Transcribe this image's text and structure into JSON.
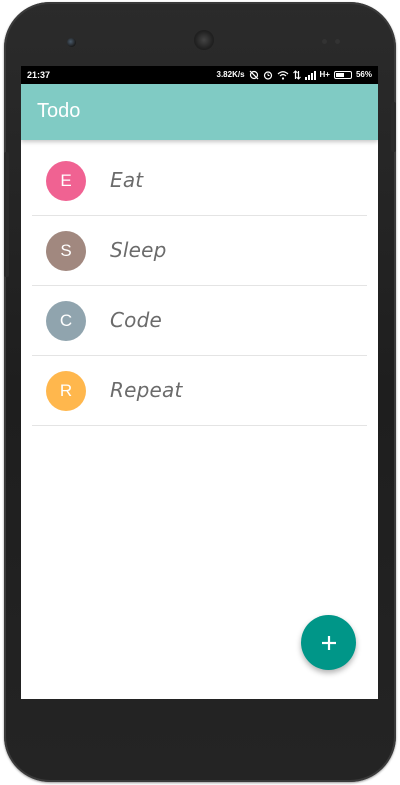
{
  "statusbar": {
    "time": "21:37",
    "network_speed": "3.82K/s",
    "network_type": "H+",
    "battery_percent": "56%",
    "battery_level": 0.56
  },
  "appbar": {
    "title": "Todo",
    "color": "#80cbc4"
  },
  "todos": [
    {
      "initial": "E",
      "label": "Eat",
      "color": "#f06292"
    },
    {
      "initial": "S",
      "label": "Sleep",
      "color": "#a1887f"
    },
    {
      "initial": "C",
      "label": "Code",
      "color": "#90a4ae"
    },
    {
      "initial": "R",
      "label": "Repeat",
      "color": "#ffb74d"
    }
  ],
  "fab": {
    "icon": "plus-icon",
    "color": "#009688"
  }
}
